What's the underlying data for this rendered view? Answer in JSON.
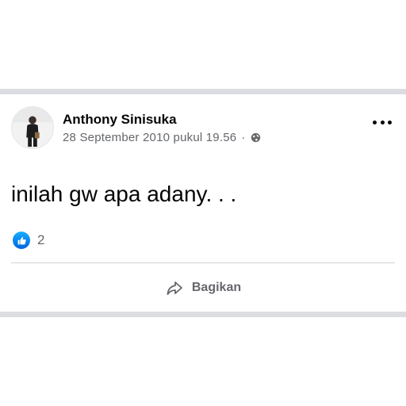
{
  "post": {
    "author": "Anthony Sinisuka",
    "timestamp": "28 September 2010 pukul 19.56",
    "separator": "·",
    "privacy_icon": "globe-icon",
    "text": "inilah gw apa adany. . .",
    "reactions": {
      "icon": "like-icon",
      "count": "2"
    },
    "actions": {
      "share_label": "Bagikan",
      "share_icon": "share-arrow-icon"
    },
    "menu_icon": "more-options-icon"
  },
  "colors": {
    "divider": "#dcdde1",
    "text_primary": "#050505",
    "text_secondary": "#65676b",
    "like_blue": "#1877f2"
  }
}
